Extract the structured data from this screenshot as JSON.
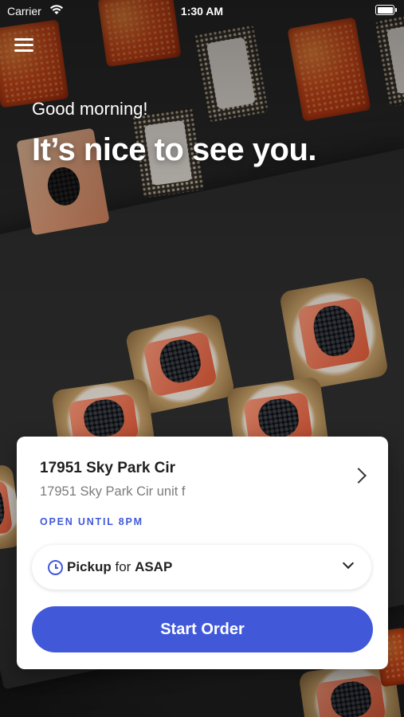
{
  "status_bar": {
    "carrier": "Carrier",
    "time": "1:30 AM"
  },
  "header": {
    "greeting": "Good morning!",
    "headline": "It’s nice to see you."
  },
  "location": {
    "name": "17951 Sky Park Cir",
    "address": "17951 Sky Park Cir unit f",
    "hours": "OPEN UNTIL 8PM"
  },
  "order": {
    "mode": "Pickup",
    "connector": "for",
    "time": "ASAP",
    "start_label": "Start Order"
  },
  "colors": {
    "accent": "#4159d9",
    "card": "#ffffff"
  },
  "icons": [
    "menu-icon",
    "wifi-icon",
    "battery-icon",
    "chevron-right-icon",
    "clock-icon",
    "chevron-down-icon"
  ]
}
